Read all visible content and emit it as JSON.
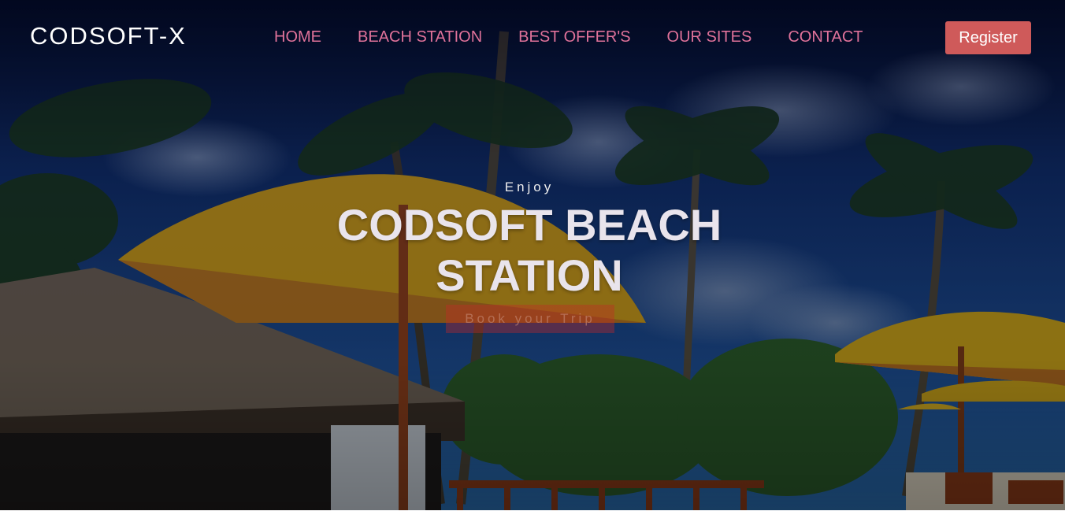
{
  "brand": {
    "logo": "CODSOFT-X"
  },
  "nav": {
    "items": [
      {
        "label": "HOME"
      },
      {
        "label": "BEACH STATION"
      },
      {
        "label": "BEST OFFER'S"
      },
      {
        "label": "OUR SITES"
      },
      {
        "label": "CONTACT"
      }
    ]
  },
  "header": {
    "register_label": "Register"
  },
  "hero": {
    "kicker": "Enjoy",
    "title_line1": "CODSOFT BEACH",
    "title_line2": "STATION",
    "cta_label": "Book your Trip"
  },
  "colors": {
    "nav_link": "#e0729a",
    "register_bg": "#cf5a5a",
    "logo": "#ffffff"
  }
}
